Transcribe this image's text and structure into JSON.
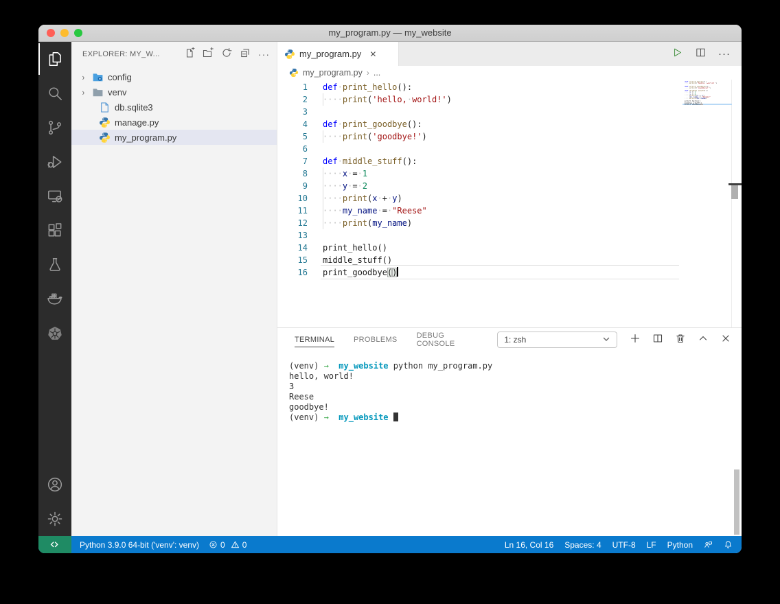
{
  "window": {
    "title": "my_program.py — my_website"
  },
  "activity_bar": {
    "items": [
      "explorer",
      "search",
      "source-control",
      "run-debug",
      "remote-explorer",
      "extensions",
      "test",
      "docker",
      "kubernetes",
      "account",
      "settings"
    ],
    "active": "explorer"
  },
  "explorer": {
    "header": "EXPLORER: MY_W...",
    "files": [
      {
        "label": "config",
        "icon": "folder-config",
        "chevron": true,
        "selected": false
      },
      {
        "label": "venv",
        "icon": "folder",
        "chevron": true,
        "selected": false
      },
      {
        "label": "db.sqlite3",
        "icon": "database-file",
        "chevron": false,
        "selected": false
      },
      {
        "label": "manage.py",
        "icon": "python",
        "chevron": false,
        "selected": false
      },
      {
        "label": "my_program.py",
        "icon": "python",
        "chevron": false,
        "selected": true
      }
    ]
  },
  "editor": {
    "tab": {
      "label": "my_program.py",
      "icon": "python"
    },
    "breadcrumb": {
      "file": "my_program.py",
      "more": "..."
    },
    "cursor": {
      "line": 16,
      "col": 16
    },
    "lines": [
      {
        "n": 1,
        "guide": false,
        "tokens": [
          {
            "t": "def",
            "c": "kw"
          },
          {
            "t": "·",
            "c": "ws"
          },
          {
            "t": "print_hello",
            "c": "fn"
          },
          {
            "t": "():",
            "c": "pl"
          }
        ]
      },
      {
        "n": 2,
        "guide": true,
        "tokens": [
          {
            "t": "····",
            "c": "ws"
          },
          {
            "t": "print",
            "c": "fn"
          },
          {
            "t": "(",
            "c": "pl"
          },
          {
            "t": "'hello,",
            "c": "str"
          },
          {
            "t": "·",
            "c": "ws"
          },
          {
            "t": "world!'",
            "c": "str"
          },
          {
            "t": ")",
            "c": "pl"
          }
        ]
      },
      {
        "n": 3,
        "guide": false,
        "tokens": []
      },
      {
        "n": 4,
        "guide": false,
        "tokens": [
          {
            "t": "def",
            "c": "kw"
          },
          {
            "t": "·",
            "c": "ws"
          },
          {
            "t": "print_goodbye",
            "c": "fn"
          },
          {
            "t": "():",
            "c": "pl"
          }
        ]
      },
      {
        "n": 5,
        "guide": true,
        "tokens": [
          {
            "t": "····",
            "c": "ws"
          },
          {
            "t": "print",
            "c": "fn"
          },
          {
            "t": "(",
            "c": "pl"
          },
          {
            "t": "'goodbye!'",
            "c": "str"
          },
          {
            "t": ")",
            "c": "pl"
          }
        ]
      },
      {
        "n": 6,
        "guide": false,
        "tokens": []
      },
      {
        "n": 7,
        "guide": false,
        "tokens": [
          {
            "t": "def",
            "c": "kw"
          },
          {
            "t": "·",
            "c": "ws"
          },
          {
            "t": "middle_stuff",
            "c": "fn"
          },
          {
            "t": "():",
            "c": "pl"
          }
        ]
      },
      {
        "n": 8,
        "guide": true,
        "tokens": [
          {
            "t": "····",
            "c": "ws"
          },
          {
            "t": "x",
            "c": "var"
          },
          {
            "t": "·",
            "c": "ws"
          },
          {
            "t": "=",
            "c": "op"
          },
          {
            "t": "·",
            "c": "ws"
          },
          {
            "t": "1",
            "c": "num"
          }
        ]
      },
      {
        "n": 9,
        "guide": true,
        "tokens": [
          {
            "t": "····",
            "c": "ws"
          },
          {
            "t": "y",
            "c": "var"
          },
          {
            "t": "·",
            "c": "ws"
          },
          {
            "t": "=",
            "c": "op"
          },
          {
            "t": "·",
            "c": "ws"
          },
          {
            "t": "2",
            "c": "num"
          }
        ]
      },
      {
        "n": 10,
        "guide": true,
        "tokens": [
          {
            "t": "····",
            "c": "ws"
          },
          {
            "t": "print",
            "c": "fn"
          },
          {
            "t": "(",
            "c": "pl"
          },
          {
            "t": "x",
            "c": "var"
          },
          {
            "t": "·",
            "c": "ws"
          },
          {
            "t": "+",
            "c": "op"
          },
          {
            "t": "·",
            "c": "ws"
          },
          {
            "t": "y",
            "c": "var"
          },
          {
            "t": ")",
            "c": "pl"
          }
        ]
      },
      {
        "n": 11,
        "guide": true,
        "tokens": [
          {
            "t": "····",
            "c": "ws"
          },
          {
            "t": "my_name",
            "c": "var"
          },
          {
            "t": "·",
            "c": "ws"
          },
          {
            "t": "=",
            "c": "op"
          },
          {
            "t": "·",
            "c": "ws"
          },
          {
            "t": "\"Reese\"",
            "c": "str"
          }
        ]
      },
      {
        "n": 12,
        "guide": true,
        "tokens": [
          {
            "t": "····",
            "c": "ws"
          },
          {
            "t": "print",
            "c": "fn"
          },
          {
            "t": "(",
            "c": "pl"
          },
          {
            "t": "my_name",
            "c": "var"
          },
          {
            "t": ")",
            "c": "pl"
          }
        ]
      },
      {
        "n": 13,
        "guide": false,
        "tokens": []
      },
      {
        "n": 14,
        "guide": false,
        "tokens": [
          {
            "t": "print_hello",
            "c": "pl"
          },
          {
            "t": "()",
            "c": "pl"
          }
        ]
      },
      {
        "n": 15,
        "guide": false,
        "tokens": [
          {
            "t": "middle_stuff",
            "c": "pl"
          },
          {
            "t": "()",
            "c": "pl"
          }
        ]
      },
      {
        "n": 16,
        "guide": false,
        "tokens": [
          {
            "t": "print_goodbye",
            "c": "pl"
          },
          {
            "t": "(",
            "c": "bm"
          },
          {
            "t": ")",
            "c": "bm"
          },
          {
            "t": "",
            "c": "caret"
          }
        ]
      }
    ]
  },
  "panel": {
    "tabs": [
      "TERMINAL",
      "PROBLEMS",
      "DEBUG CONSOLE"
    ],
    "active_tab": "TERMINAL",
    "shell_select": "1: zsh",
    "terminal_lines": [
      {
        "tokens": [
          {
            "t": "(venv) ",
            "c": "t"
          },
          {
            "t": "→",
            "c": "arrow"
          },
          {
            "t": "  ",
            "c": "t"
          },
          {
            "t": "my_website",
            "c": "dir"
          },
          {
            "t": " python my_program.py",
            "c": "t"
          }
        ]
      },
      {
        "tokens": [
          {
            "t": "hello, world!",
            "c": "t"
          }
        ]
      },
      {
        "tokens": [
          {
            "t": "3",
            "c": "t"
          }
        ]
      },
      {
        "tokens": [
          {
            "t": "Reese",
            "c": "t"
          }
        ]
      },
      {
        "tokens": [
          {
            "t": "goodbye!",
            "c": "t"
          }
        ]
      },
      {
        "tokens": [
          {
            "t": "(venv) ",
            "c": "t"
          },
          {
            "t": "→",
            "c": "arrow"
          },
          {
            "t": "  ",
            "c": "t"
          },
          {
            "t": "my_website",
            "c": "dir"
          },
          {
            "t": " ",
            "c": "t"
          },
          {
            "t": "",
            "c": "block"
          }
        ]
      }
    ]
  },
  "status_bar": {
    "python_version": "Python 3.9.0 64-bit ('venv': venv)",
    "errors": "0",
    "warnings": "0",
    "cursor_position": "Ln 16, Col 16",
    "indent": "Spaces: 4",
    "encoding": "UTF-8",
    "eol": "LF",
    "language": "Python"
  },
  "colors": {
    "status_bar_blue": "#0a7acd",
    "remote_green": "#1f8b64",
    "selected_row": "#e4e6f1",
    "keyword": "#0000ff",
    "function": "#795E26",
    "string": "#a31515",
    "number": "#098658",
    "variable": "#001080",
    "line_number": "#237893",
    "terminal_directory": "#0598bc",
    "terminal_arrow": "#39a849"
  }
}
